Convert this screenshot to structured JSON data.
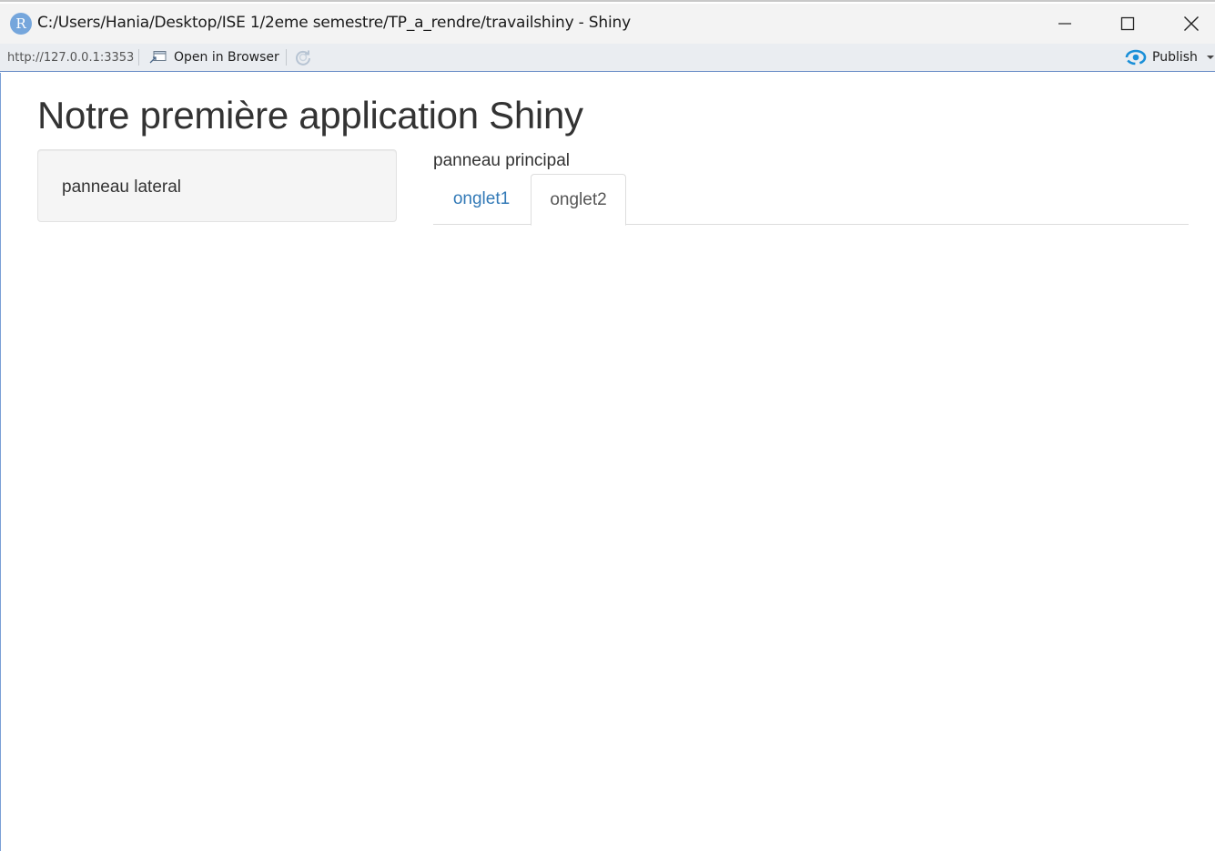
{
  "window": {
    "title": "C:/Users/Hania/Desktop/ISE 1/2eme semestre/TP_a_rendre/travailshiny - Shiny",
    "app_icon_letter": "R"
  },
  "toolbar": {
    "url": "http://127.0.0.1:3353",
    "open_in_browser_label": "Open in Browser",
    "publish_label": "Publish",
    "publish_color": "#1a8fd8"
  },
  "app": {
    "title": "Notre première application Shiny",
    "sidebar_text": "panneau lateral",
    "main_text": "panneau principal",
    "tabs": [
      {
        "label": "onglet1",
        "active": false
      },
      {
        "label": "onglet2",
        "active": true
      }
    ],
    "link_color": "#337ab7"
  }
}
